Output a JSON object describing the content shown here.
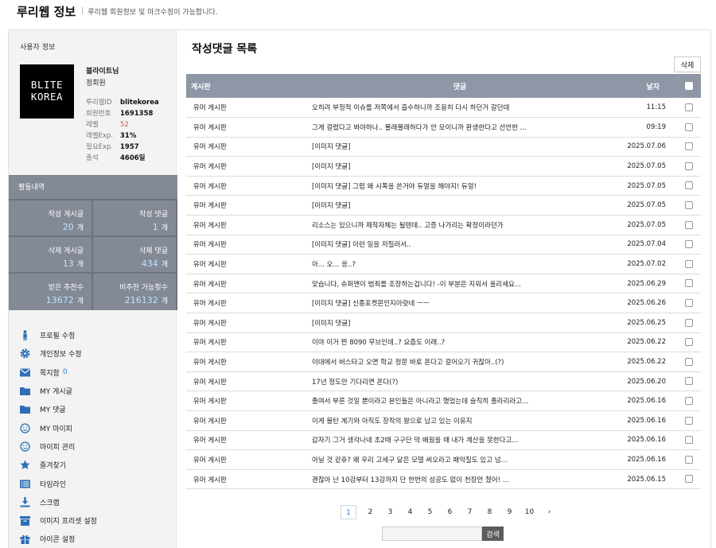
{
  "header": {
    "title": "루리웹 정보",
    "description": "루리웹 회원정보 및 마크수정이 가능합니다."
  },
  "user": {
    "section_label": "사용자 정보",
    "logo_line1": "BLITE",
    "logo_line2": "KOREA",
    "name": "블라이트님",
    "grade": "정회원",
    "stats": [
      {
        "key": "루리웹ID",
        "value": "blitekorea"
      },
      {
        "key": "회원번호",
        "value": "1691358"
      },
      {
        "key": "레벨",
        "value": "52"
      },
      {
        "key": "레벨Exp.",
        "value": "31%"
      },
      {
        "key": "필요Exp.",
        "value": "1957"
      },
      {
        "key": "출석",
        "value": "4606일"
      }
    ]
  },
  "activity": {
    "header": "활동내역",
    "cells": [
      {
        "label": "작성 게시글",
        "num": "20",
        "unit": "개"
      },
      {
        "label": "작성 댓글",
        "num": "1",
        "unit": "개"
      },
      {
        "label": "삭제 게시글",
        "num": "13",
        "unit": "개"
      },
      {
        "label": "삭제 댓글",
        "num": "434",
        "unit": "개"
      },
      {
        "label": "받은 추천수",
        "num": "13672",
        "unit": "개"
      },
      {
        "label": "비추천 가능횟수",
        "num": "216132",
        "unit": "개"
      }
    ]
  },
  "menu": [
    {
      "label": "프로필 수정",
      "icon": "person-icon"
    },
    {
      "label": "개인정보 수정",
      "icon": "gear-icon"
    },
    {
      "label": "쪽지함",
      "icon": "envelope-icon",
      "count": "0"
    },
    {
      "label": "MY 게시글",
      "icon": "folder-icon"
    },
    {
      "label": "MY 댓글",
      "icon": "folder-icon"
    },
    {
      "label": "MY 마이피",
      "icon": "smiley-icon"
    },
    {
      "label": "마이피 관리",
      "icon": "smiley-icon"
    },
    {
      "label": "즐겨찾기",
      "icon": "star-icon"
    },
    {
      "label": "타임라인",
      "icon": "timeline-icon"
    },
    {
      "label": "스크랩",
      "icon": "download-icon"
    },
    {
      "label": "이미지 프리셋 설정",
      "icon": "archive-icon"
    },
    {
      "label": "아이콘 설정",
      "icon": "gift-icon"
    }
  ],
  "main": {
    "title": "작성댓글 목록",
    "delete_label": "삭제",
    "columns": {
      "board": "게시판",
      "comment": "댓글",
      "date": "날자"
    },
    "rows": [
      {
        "board": "유머 게시판",
        "comment": "오히려 부정적 이슈를 저쪽에서 흡수하니까 조용히 다시 하던거 갈던데",
        "date": "11:15"
      },
      {
        "board": "유머 게시판",
        "comment": "그게 걸렸다고 봐야하나.. 몰래몰래하다가 안 모이니까 환생한다고 선언한 ...",
        "date": "09:19"
      },
      {
        "board": "유머 게시판",
        "comment": "[이미지 댓글]",
        "date": "2025.07.06"
      },
      {
        "board": "유머 게시판",
        "comment": "[이미지 댓글]",
        "date": "2025.07.05"
      },
      {
        "board": "유머 게시판",
        "comment": "[이미지 댓글] 그럼 왜 시폭을 쓴거야 듀얼을 해야지! 듀얼!",
        "date": "2025.07.05"
      },
      {
        "board": "유머 게시판",
        "comment": "[이미지 댓글]",
        "date": "2025.07.05"
      },
      {
        "board": "유머 게시판",
        "comment": "리소스는 있으니까 제작자체는 될텐데.. 고증 나가리는 확정이라던가",
        "date": "2025.07.05"
      },
      {
        "board": "유머 게시판",
        "comment": "[이미지 댓글] 이런 일을 저질러서..",
        "date": "2025.07.04"
      },
      {
        "board": "유머 게시판",
        "comment": "아... 오... 응..?",
        "date": "2025.07.02"
      },
      {
        "board": "유머 게시판",
        "comment": "맞습니다, 슈퍼맨이 범죄를 조장하는겁니다! -이 부분은 지워서 올리세요...",
        "date": "2025.06.29"
      },
      {
        "board": "유머 게시판",
        "comment": "[이미지 댓글] 신종포켓몬인지아랏네 ㅡㅡ",
        "date": "2025.06.26"
      },
      {
        "board": "유머 게시판",
        "comment": "[이미지 댓글]",
        "date": "2025.06.25"
      },
      {
        "board": "유머 게시판",
        "comment": "이야 이거 찐 8090 무브인데..? 요즘도 이래..?",
        "date": "2025.06.22"
      },
      {
        "board": "유머 게시판",
        "comment": "이대에서 버스타고 오면 학교 정문 바로 온다고 걸어오기 귀찮아..(?)",
        "date": "2025.06.22"
      },
      {
        "board": "유머 게시판",
        "comment": "17년 정도만 기다리면 온다(?)",
        "date": "2025.06.20"
      },
      {
        "board": "유머 게시판",
        "comment": "졸여서 부른 것일 뿐이라고 본인들은 아니라고 했었는데 슬직히 졸라리라고...",
        "date": "2025.06.16"
      },
      {
        "board": "유머 게시판",
        "comment": "이게 불탄 계기와 아직도 장작의 왕으로 남고 있는 이유지",
        "date": "2025.06.16"
      },
      {
        "board": "유머 게시판",
        "comment": "갑자기 그거 생각나네 초2때 구구단 막 배웠을 때 내가 계산을 못한다고...",
        "date": "2025.06.16"
      },
      {
        "board": "유머 게시판",
        "comment": "아닐 것 같쥬? 왜 우리 고세구 닮은 모델 써오라고 패악질도 있고 넘...",
        "date": "2025.06.16"
      },
      {
        "board": "유머 게시판",
        "comment": "괜찮아 난 10강부터 13강까지 단 한번의 성공도 없이 천장만 쳤어! ...",
        "date": "2025.06.15"
      }
    ],
    "pages": [
      "1",
      "2",
      "3",
      "4",
      "5",
      "6",
      "7",
      "8",
      "9",
      "10"
    ],
    "next_label": "›",
    "search_button": "검색",
    "search_value": ""
  }
}
